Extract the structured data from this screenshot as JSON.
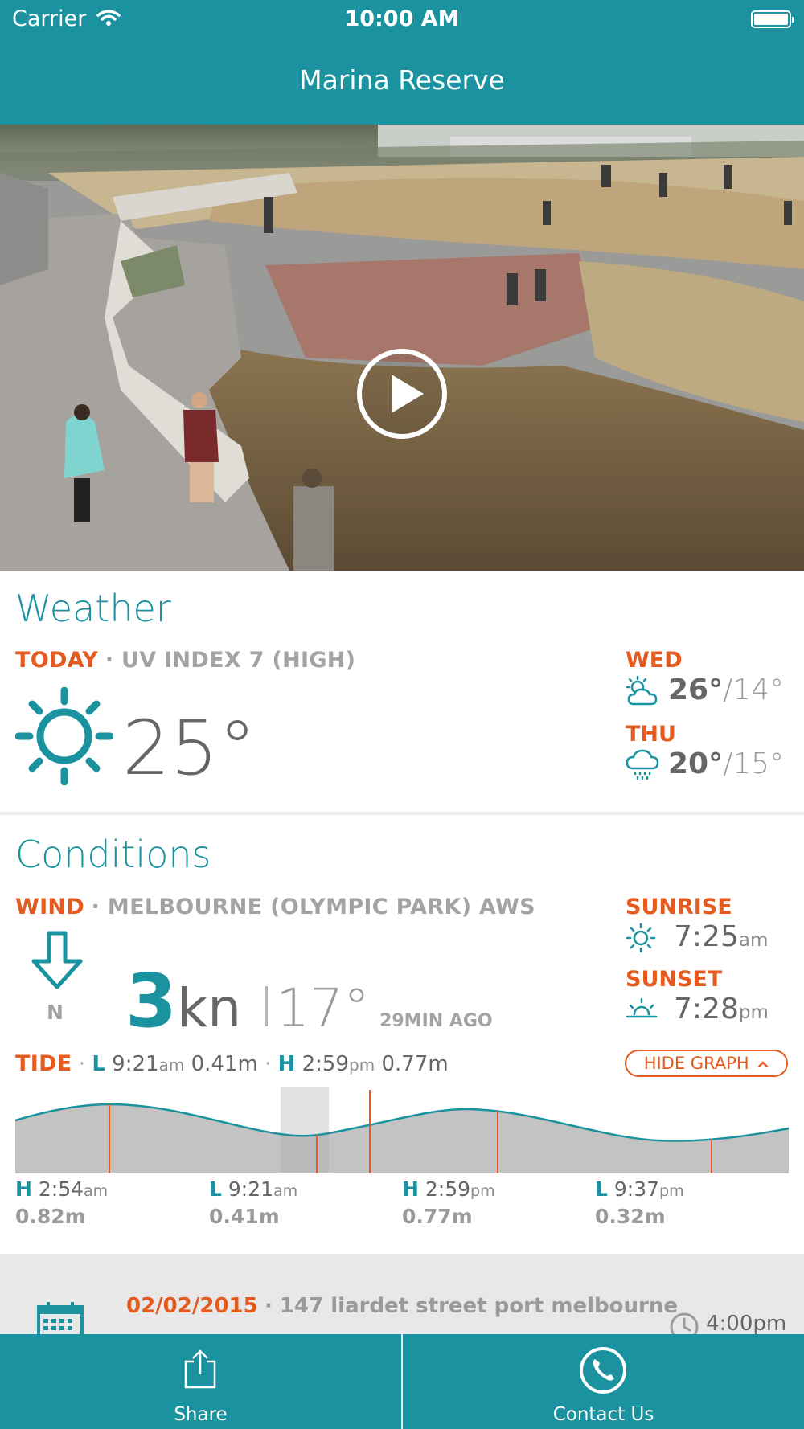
{
  "status_bar": {
    "carrier": "Carrier",
    "time": "10:00 AM"
  },
  "nav": {
    "title": "Marina Reserve"
  },
  "weather": {
    "title": "Weather",
    "today_label": "TODAY",
    "uv_text": "UV INDEX 7 (HIGH)",
    "current_temp": "25°",
    "forecast": [
      {
        "day": "WED",
        "hi": "26°",
        "sep": "/",
        "lo": "14°",
        "icon": "partly-cloudy-icon"
      },
      {
        "day": "THU",
        "hi": "20°",
        "sep": "/",
        "lo": "15°",
        "icon": "rain-cloud-icon"
      }
    ]
  },
  "conditions": {
    "title": "Conditions",
    "wind_label": "WIND",
    "station": "MELBOURNE (OLYMPIC PARK) AWS",
    "wind_dir": "N",
    "wind_speed": "3",
    "wind_unit": "kn",
    "wind_temp": "17°",
    "updated": "29MIN AGO",
    "sunrise_label": "SUNRISE",
    "sunrise_time": "7:25",
    "sunrise_ampm": "am",
    "sunset_label": "SUNSET",
    "sunset_time": "7:28",
    "sunset_ampm": "pm"
  },
  "tide": {
    "label": "TIDE",
    "summary": {
      "low_letter": "L",
      "low_time": "9:21",
      "low_ampm": "am",
      "low_height": "0.41m",
      "high_letter": "H",
      "high_time": "2:59",
      "high_ampm": "pm",
      "high_height": "0.77m"
    },
    "hide_graph": "HIDE GRAPH",
    "events": [
      {
        "type": "H",
        "time": "2:54",
        "ampm": "am",
        "height": "0.82m"
      },
      {
        "type": "L",
        "time": "9:21",
        "ampm": "am",
        "height": "0.41m"
      },
      {
        "type": "H",
        "time": "2:59",
        "ampm": "pm",
        "height": "0.77m"
      },
      {
        "type": "L",
        "time": "9:37",
        "ampm": "pm",
        "height": "0.32m"
      }
    ]
  },
  "event": {
    "date": "02/02/2015",
    "address": "147 liardet street port melbourne",
    "time": "4:00pm"
  },
  "tabs": {
    "share": "Share",
    "contact": "Contact Us"
  },
  "colors": {
    "teal": "#1a92a0",
    "orange": "#e45a1f"
  }
}
